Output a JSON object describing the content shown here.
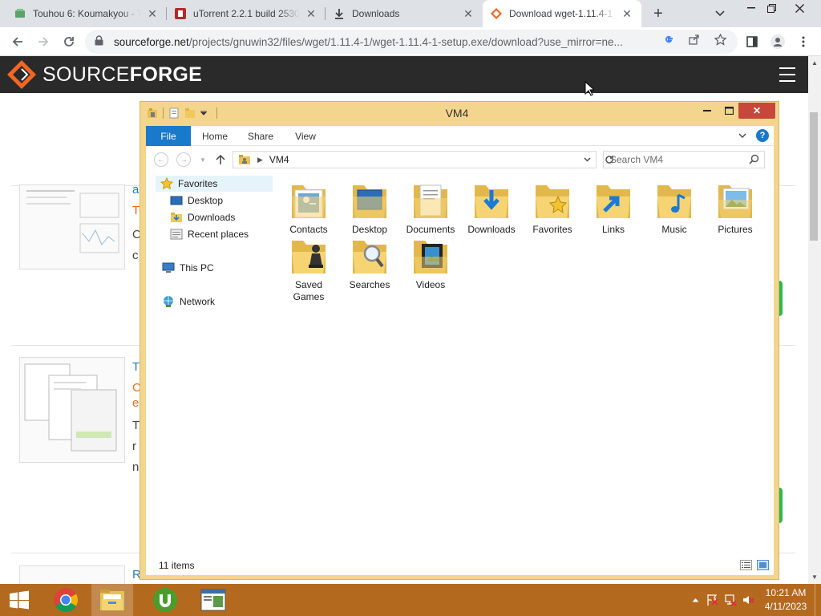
{
  "browser": {
    "tabs": [
      {
        "title": "Touhou 6: Koumakyou - T",
        "icon": "puzzle-icon",
        "active": false
      },
      {
        "title": "uTorrent 2.2.1 build 2530",
        "icon": "utorrent-icon",
        "active": false
      },
      {
        "title": "Downloads",
        "icon": "download-icon",
        "active": false
      },
      {
        "title": "Download wget-1.11.4-1",
        "icon": "sourceforge-icon",
        "active": true
      }
    ],
    "new_tab": "+",
    "url_host": "sourceforge.net",
    "url_path": "/projects/gnuwin32/files/wget/1.11.4-1/wget-1.11.4-1-setup.exe/download?use_mirror=ne..."
  },
  "sourceforge": {
    "logo_light": "SOURCE",
    "logo_bold": "FORGE",
    "partial_texts": [
      "a",
      "T",
      "C",
      "c",
      "T",
      "C",
      "e",
      "T",
      "r",
      "n",
      "R"
    ]
  },
  "explorer": {
    "title": "VM4",
    "ribbon_tabs": [
      "File",
      "Home",
      "Share",
      "View"
    ],
    "address": "VM4",
    "search_placeholder": "Search VM4",
    "nav": {
      "favorites": "Favorites",
      "desktop": "Desktop",
      "downloads": "Downloads",
      "recent": "Recent places",
      "thispc": "This PC",
      "network": "Network"
    },
    "items": [
      {
        "label": "Contacts",
        "icon": "contacts-folder-icon"
      },
      {
        "label": "Desktop",
        "icon": "desktop-folder-icon"
      },
      {
        "label": "Documents",
        "icon": "documents-folder-icon"
      },
      {
        "label": "Downloads",
        "icon": "downloads-folder-icon"
      },
      {
        "label": "Favorites",
        "icon": "favorites-folder-icon"
      },
      {
        "label": "Links",
        "icon": "links-folder-icon"
      },
      {
        "label": "Music",
        "icon": "music-folder-icon"
      },
      {
        "label": "Pictures",
        "icon": "pictures-folder-icon"
      },
      {
        "label": "Saved Games",
        "icon": "saved-games-folder-icon"
      },
      {
        "label": "Searches",
        "icon": "searches-folder-icon"
      },
      {
        "label": "Videos",
        "icon": "videos-folder-icon"
      }
    ],
    "status": "11 items"
  },
  "taskbar": {
    "time": "10:21 AM",
    "date": "4/11/2023"
  },
  "colors": {
    "explorer_frame": "#f4d58e",
    "ribbon_file": "#1979ca",
    "taskbar": "#b36a1e",
    "sourceforge_orange": "#f26722"
  }
}
